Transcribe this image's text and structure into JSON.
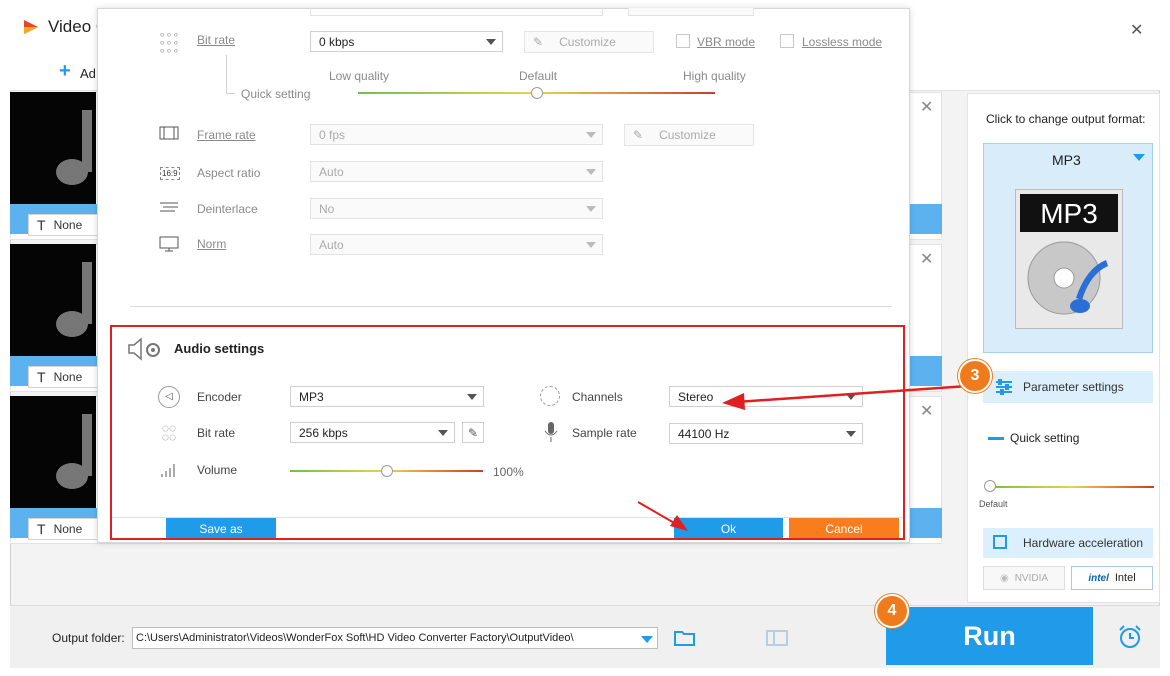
{
  "app": {
    "title": "Video C",
    "add_label": "Ad"
  },
  "window_controls": {
    "close": "✕"
  },
  "file_list": {
    "items": [
      {
        "subtitle": "None"
      },
      {
        "subtitle": "None"
      },
      {
        "subtitle": "None"
      }
    ]
  },
  "right_panel": {
    "hint": "Click to change output format:",
    "format_name": "MP3",
    "format_icon_text": "MP3",
    "parameter_settings": "Parameter settings",
    "quick_setting": "Quick setting",
    "quick_default": "Default",
    "hardware_acceleration": "Hardware acceleration",
    "nvidia": "NVIDIA",
    "intel": "Intel"
  },
  "bottom": {
    "output_folder_label": "Output folder:",
    "output_folder_value": "C:\\Users\\Administrator\\Videos\\WonderFox Soft\\HD Video Converter Factory\\OutputVideo\\",
    "run": "Run"
  },
  "badges": {
    "step3": "3",
    "step4": "4"
  },
  "dialog": {
    "video": {
      "bit_rate_label": "Bit rate",
      "bit_rate_value": "0 kbps",
      "customize": "Customize",
      "vbr_mode": "VBR mode",
      "lossless_mode": "Lossless mode",
      "quick_setting": "Quick setting",
      "low_quality": "Low quality",
      "default": "Default",
      "high_quality": "High quality",
      "quality_level": 0.5,
      "frame_rate_label": "Frame rate",
      "frame_rate_value": "0 fps",
      "frame_customize": "Customize",
      "aspect_ratio_label": "Aspect ratio",
      "aspect_ratio_value": "Auto",
      "aspect_icon": "16:9",
      "deinterlace_label": "Deinterlace",
      "deinterlace_value": "No",
      "norm_label": "Norm",
      "norm_value": "Auto"
    },
    "audio": {
      "section_title": "Audio settings",
      "encoder_label": "Encoder",
      "encoder_value": "MP3",
      "bit_rate_label": "Bit rate",
      "bit_rate_value": "256 kbps",
      "volume_label": "Volume",
      "volume_value": "100%",
      "volume_level": 0.5,
      "channels_label": "Channels",
      "channels_value": "Stereo",
      "sample_rate_label": "Sample rate",
      "sample_rate_value": "44100 Hz"
    },
    "buttons": {
      "save_as": "Save as",
      "ok": "Ok",
      "cancel": "Cancel"
    }
  },
  "colors": {
    "accent_blue": "#1f9be9",
    "highlight_red": "#e02020",
    "cancel_orange": "#f77d1e",
    "badge_orange": "#f07b1c"
  }
}
